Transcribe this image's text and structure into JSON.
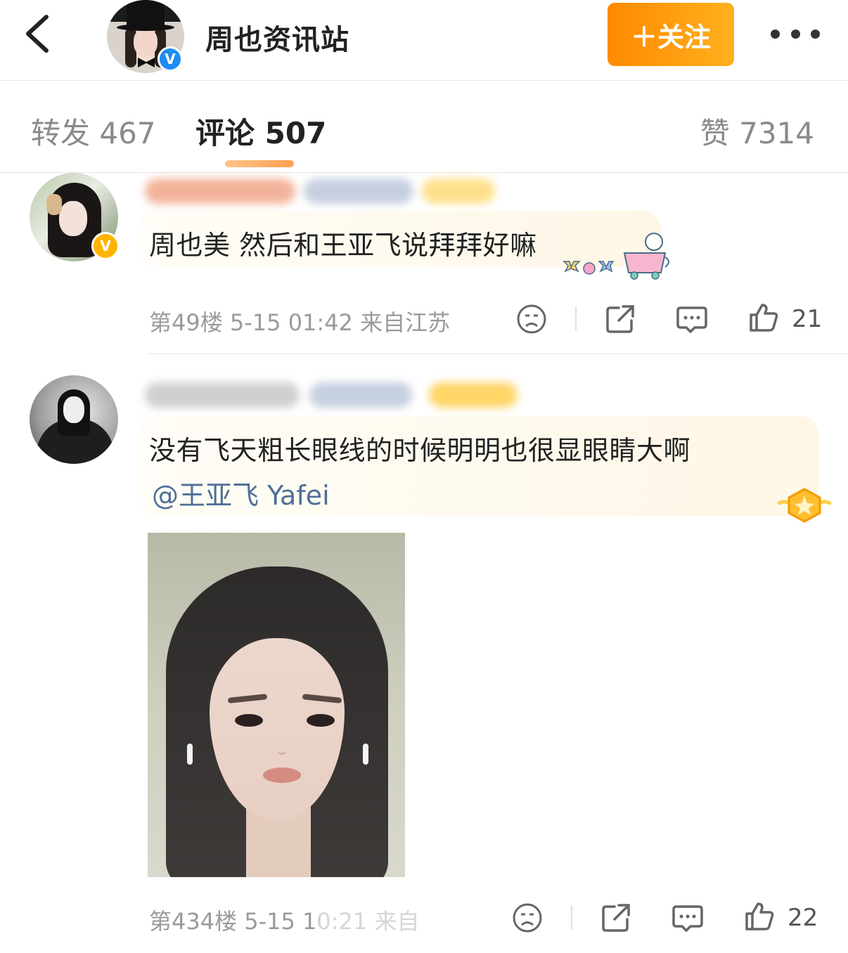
{
  "header": {
    "account_name": "周也资讯站",
    "verified_badge": "V",
    "follow_label": "＋关注"
  },
  "tabs": {
    "repost": "转发 467",
    "comments": "评论 507",
    "likes": "赞 7314"
  },
  "comments": [
    {
      "text": "周也美 然后和王亚飞说拜拜好嘛",
      "badge": "V",
      "meta": "第49楼 5-15 01:42 来自江苏",
      "like_count": "21"
    },
    {
      "text": "没有飞天粗长眼线的时候明明也很显眼睛大啊",
      "mention": "@王亚飞 Yafei",
      "meta": "第434楼 5-15 10:21 来自",
      "like_count": "22"
    }
  ],
  "colors": {
    "follow_button": "#ff9a0e",
    "mention": "#4f6f96",
    "verified_blue": "#1e8cf0",
    "verified_gold": "#ffb400"
  }
}
